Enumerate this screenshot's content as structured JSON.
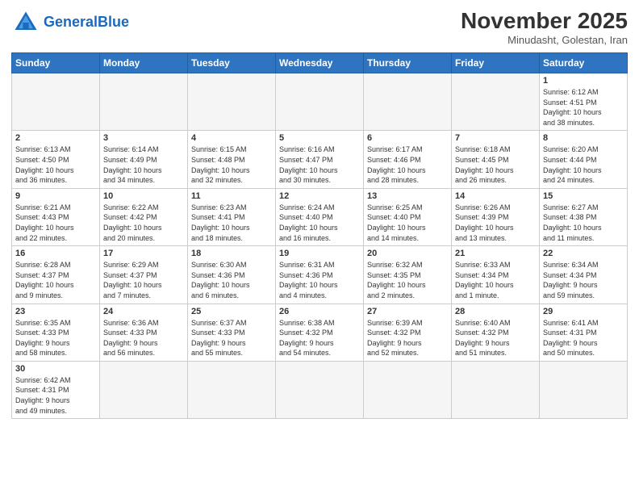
{
  "header": {
    "logo_general": "General",
    "logo_blue": "Blue",
    "month_title": "November 2025",
    "subtitle": "Minudasht, Golestan, Iran"
  },
  "weekdays": [
    "Sunday",
    "Monday",
    "Tuesday",
    "Wednesday",
    "Thursday",
    "Friday",
    "Saturday"
  ],
  "weeks": [
    [
      {
        "day": "",
        "info": ""
      },
      {
        "day": "",
        "info": ""
      },
      {
        "day": "",
        "info": ""
      },
      {
        "day": "",
        "info": ""
      },
      {
        "day": "",
        "info": ""
      },
      {
        "day": "",
        "info": ""
      },
      {
        "day": "1",
        "info": "Sunrise: 6:12 AM\nSunset: 4:51 PM\nDaylight: 10 hours\nand 38 minutes."
      }
    ],
    [
      {
        "day": "2",
        "info": "Sunrise: 6:13 AM\nSunset: 4:50 PM\nDaylight: 10 hours\nand 36 minutes."
      },
      {
        "day": "3",
        "info": "Sunrise: 6:14 AM\nSunset: 4:49 PM\nDaylight: 10 hours\nand 34 minutes."
      },
      {
        "day": "4",
        "info": "Sunrise: 6:15 AM\nSunset: 4:48 PM\nDaylight: 10 hours\nand 32 minutes."
      },
      {
        "day": "5",
        "info": "Sunrise: 6:16 AM\nSunset: 4:47 PM\nDaylight: 10 hours\nand 30 minutes."
      },
      {
        "day": "6",
        "info": "Sunrise: 6:17 AM\nSunset: 4:46 PM\nDaylight: 10 hours\nand 28 minutes."
      },
      {
        "day": "7",
        "info": "Sunrise: 6:18 AM\nSunset: 4:45 PM\nDaylight: 10 hours\nand 26 minutes."
      },
      {
        "day": "8",
        "info": "Sunrise: 6:20 AM\nSunset: 4:44 PM\nDaylight: 10 hours\nand 24 minutes."
      }
    ],
    [
      {
        "day": "9",
        "info": "Sunrise: 6:21 AM\nSunset: 4:43 PM\nDaylight: 10 hours\nand 22 minutes."
      },
      {
        "day": "10",
        "info": "Sunrise: 6:22 AM\nSunset: 4:42 PM\nDaylight: 10 hours\nand 20 minutes."
      },
      {
        "day": "11",
        "info": "Sunrise: 6:23 AM\nSunset: 4:41 PM\nDaylight: 10 hours\nand 18 minutes."
      },
      {
        "day": "12",
        "info": "Sunrise: 6:24 AM\nSunset: 4:40 PM\nDaylight: 10 hours\nand 16 minutes."
      },
      {
        "day": "13",
        "info": "Sunrise: 6:25 AM\nSunset: 4:40 PM\nDaylight: 10 hours\nand 14 minutes."
      },
      {
        "day": "14",
        "info": "Sunrise: 6:26 AM\nSunset: 4:39 PM\nDaylight: 10 hours\nand 13 minutes."
      },
      {
        "day": "15",
        "info": "Sunrise: 6:27 AM\nSunset: 4:38 PM\nDaylight: 10 hours\nand 11 minutes."
      }
    ],
    [
      {
        "day": "16",
        "info": "Sunrise: 6:28 AM\nSunset: 4:37 PM\nDaylight: 10 hours\nand 9 minutes."
      },
      {
        "day": "17",
        "info": "Sunrise: 6:29 AM\nSunset: 4:37 PM\nDaylight: 10 hours\nand 7 minutes."
      },
      {
        "day": "18",
        "info": "Sunrise: 6:30 AM\nSunset: 4:36 PM\nDaylight: 10 hours\nand 6 minutes."
      },
      {
        "day": "19",
        "info": "Sunrise: 6:31 AM\nSunset: 4:36 PM\nDaylight: 10 hours\nand 4 minutes."
      },
      {
        "day": "20",
        "info": "Sunrise: 6:32 AM\nSunset: 4:35 PM\nDaylight: 10 hours\nand 2 minutes."
      },
      {
        "day": "21",
        "info": "Sunrise: 6:33 AM\nSunset: 4:34 PM\nDaylight: 10 hours\nand 1 minute."
      },
      {
        "day": "22",
        "info": "Sunrise: 6:34 AM\nSunset: 4:34 PM\nDaylight: 9 hours\nand 59 minutes."
      }
    ],
    [
      {
        "day": "23",
        "info": "Sunrise: 6:35 AM\nSunset: 4:33 PM\nDaylight: 9 hours\nand 58 minutes."
      },
      {
        "day": "24",
        "info": "Sunrise: 6:36 AM\nSunset: 4:33 PM\nDaylight: 9 hours\nand 56 minutes."
      },
      {
        "day": "25",
        "info": "Sunrise: 6:37 AM\nSunset: 4:33 PM\nDaylight: 9 hours\nand 55 minutes."
      },
      {
        "day": "26",
        "info": "Sunrise: 6:38 AM\nSunset: 4:32 PM\nDaylight: 9 hours\nand 54 minutes."
      },
      {
        "day": "27",
        "info": "Sunrise: 6:39 AM\nSunset: 4:32 PM\nDaylight: 9 hours\nand 52 minutes."
      },
      {
        "day": "28",
        "info": "Sunrise: 6:40 AM\nSunset: 4:32 PM\nDaylight: 9 hours\nand 51 minutes."
      },
      {
        "day": "29",
        "info": "Sunrise: 6:41 AM\nSunset: 4:31 PM\nDaylight: 9 hours\nand 50 minutes."
      }
    ],
    [
      {
        "day": "30",
        "info": "Sunrise: 6:42 AM\nSunset: 4:31 PM\nDaylight: 9 hours\nand 49 minutes."
      },
      {
        "day": "",
        "info": ""
      },
      {
        "day": "",
        "info": ""
      },
      {
        "day": "",
        "info": ""
      },
      {
        "day": "",
        "info": ""
      },
      {
        "day": "",
        "info": ""
      },
      {
        "day": "",
        "info": ""
      }
    ]
  ]
}
